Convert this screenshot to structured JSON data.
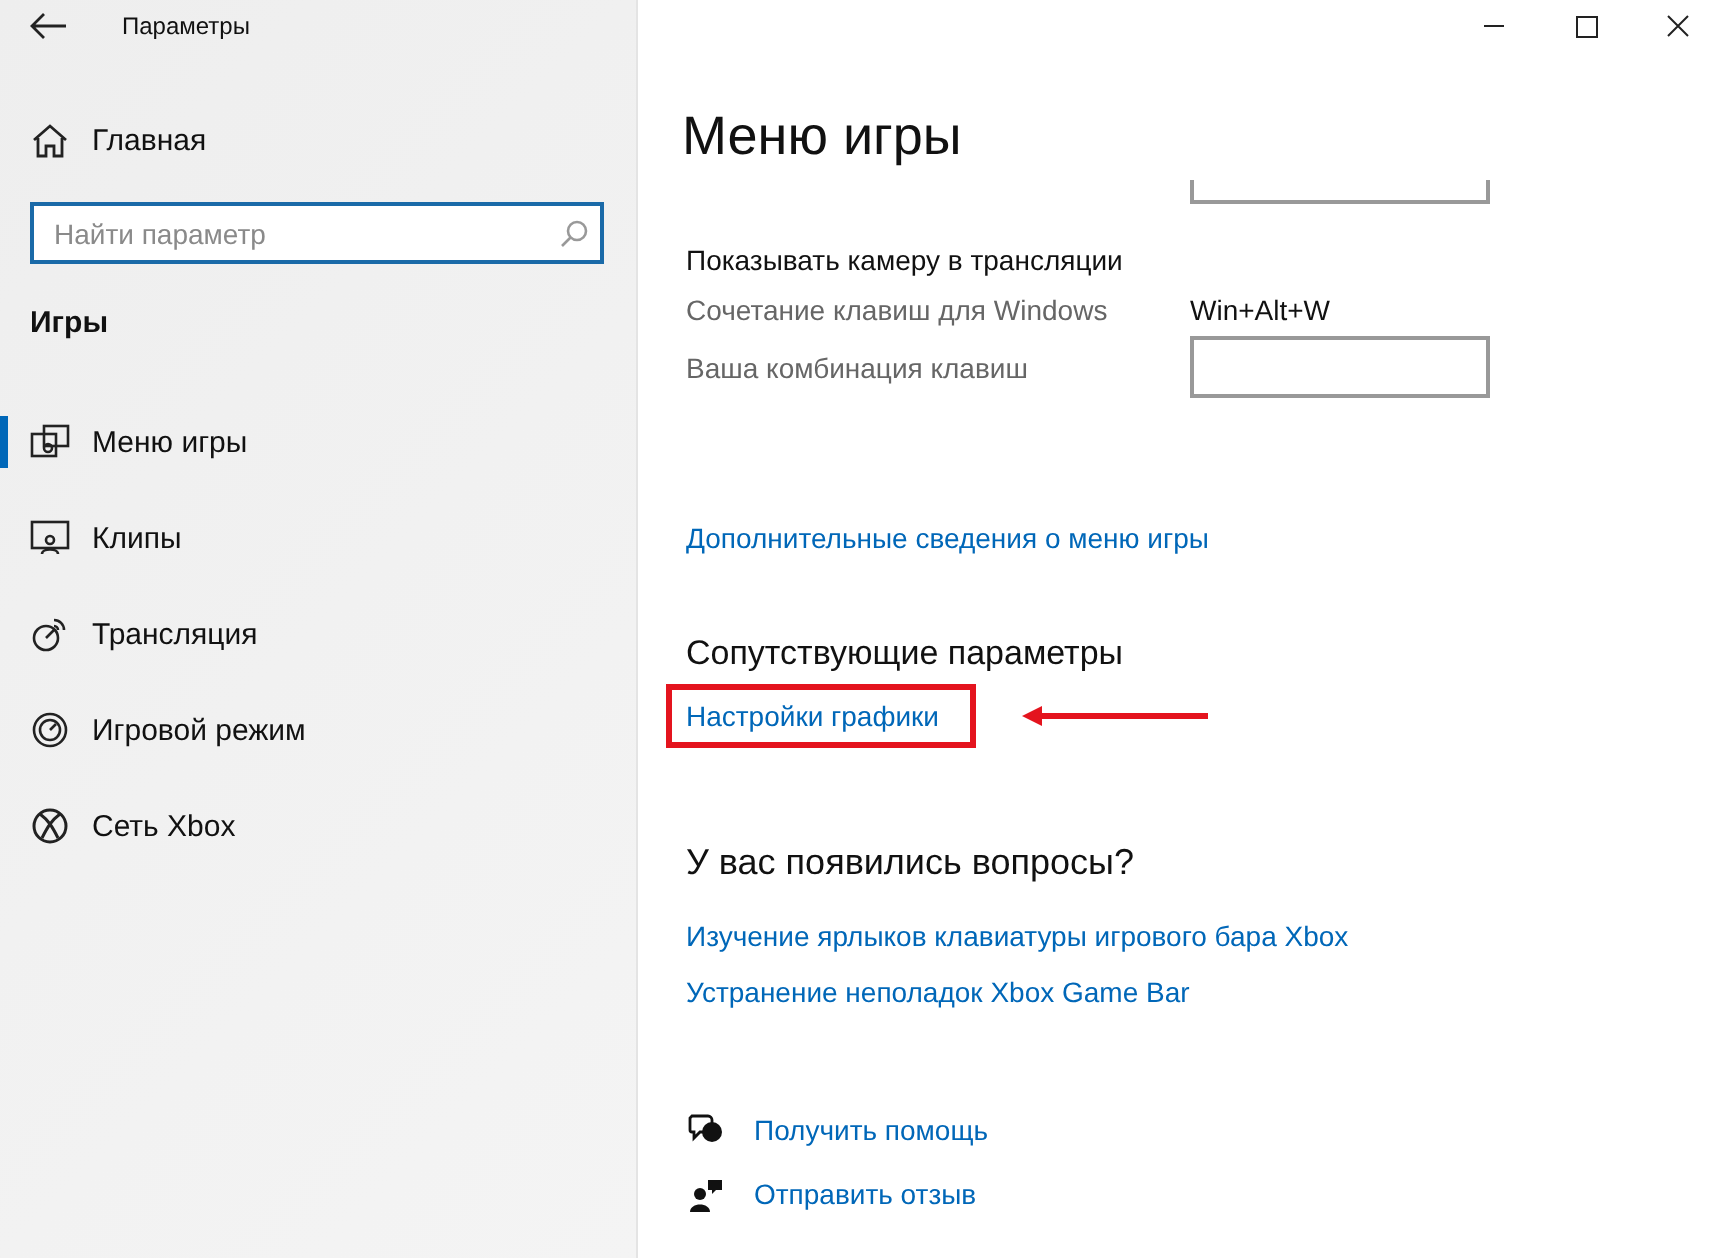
{
  "window": {
    "title": "Параметры"
  },
  "sidebar": {
    "home": "Главная",
    "search": {
      "placeholder": "Найти параметр"
    },
    "section": "Игры",
    "items": [
      {
        "label": "Меню игры",
        "kind": "game-menu",
        "selected": true
      },
      {
        "label": "Клипы",
        "kind": "clips",
        "selected": false
      },
      {
        "label": "Трансляция",
        "kind": "broadcast",
        "selected": false
      },
      {
        "label": "Игровой режим",
        "kind": "game-mode",
        "selected": false
      },
      {
        "label": "Сеть Xbox",
        "kind": "xbox",
        "selected": false
      }
    ]
  },
  "page": {
    "title": "Меню игры",
    "rows": [
      {
        "kind": "input"
      },
      {
        "kind": "heading",
        "label": "Показывать камеру в трансляции"
      },
      {
        "kind": "text",
        "label": "Сочетание клавиш для Windows",
        "value": "Win+Alt+W"
      },
      {
        "kind": "input",
        "label": "Ваша комбинация клавиш"
      }
    ],
    "more_link": "Дополнительные сведения о меню игры",
    "related": {
      "heading": "Сопутствующие параметры",
      "links": [
        {
          "label": "Настройки графики",
          "highlighted": true
        }
      ]
    },
    "questions": {
      "heading": "У вас появились вопросы?",
      "links": [
        {
          "label": "Изучение ярлыков клавиатуры игрового бара Xbox"
        },
        {
          "label": "Устранение неполадок Xbox Game Bar"
        }
      ]
    },
    "help": [
      {
        "kind": "help",
        "label": "Получить помощь"
      },
      {
        "kind": "feedback",
        "label": "Отправить отзыв"
      }
    ]
  }
}
